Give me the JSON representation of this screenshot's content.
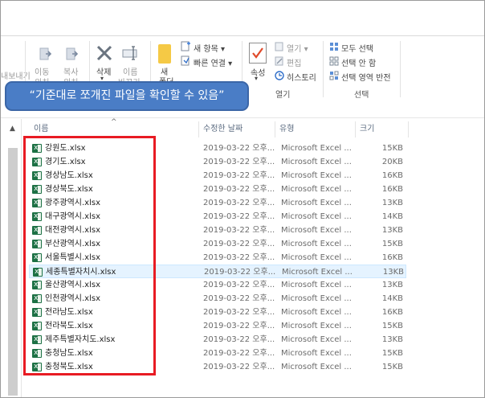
{
  "ribbon": {
    "left_edge_label": "내보내기",
    "move_to": [
      "이동",
      "위치"
    ],
    "copy_to": [
      "복사",
      "위치"
    ],
    "delete": [
      "삭제",
      "▾"
    ],
    "rename": [
      "이름",
      "바꾸기"
    ],
    "new_folder": [
      "새",
      "폴더"
    ],
    "new_item": "새 항목 ▾",
    "easy_access": "빠른 연결 ▾",
    "properties": [
      "속성",
      "▾"
    ],
    "open": "열기 ▾",
    "edit": "편집",
    "history": "히스토리",
    "open_group": "열기",
    "select_all": "모두 선택",
    "select_none": "선택 안 함",
    "invert_selection": "선택 영역 반전",
    "select_group": "선택"
  },
  "callout": {
    "text": "“기준대로 쪼개진 파일을 확인할 수 있음”"
  },
  "columns": {
    "name": "이름",
    "date": "수정한 날짜",
    "type": "유형",
    "size": "크기"
  },
  "files": [
    {
      "name": "강원도.xlsx",
      "date": "2019-03-22 오후...",
      "type": "Microsoft Excel ...",
      "size": "15KB"
    },
    {
      "name": "경기도.xlsx",
      "date": "2019-03-22 오후...",
      "type": "Microsoft Excel ...",
      "size": "20KB"
    },
    {
      "name": "경상남도.xlsx",
      "date": "2019-03-22 오후...",
      "type": "Microsoft Excel ...",
      "size": "16KB"
    },
    {
      "name": "경상북도.xlsx",
      "date": "2019-03-22 오후...",
      "type": "Microsoft Excel ...",
      "size": "16KB"
    },
    {
      "name": "광주광역시.xlsx",
      "date": "2019-03-22 오후...",
      "type": "Microsoft Excel ...",
      "size": "13KB"
    },
    {
      "name": "대구광역시.xlsx",
      "date": "2019-03-22 오후...",
      "type": "Microsoft Excel ...",
      "size": "14KB"
    },
    {
      "name": "대전광역시.xlsx",
      "date": "2019-03-22 오후...",
      "type": "Microsoft Excel ...",
      "size": "13KB"
    },
    {
      "name": "부산광역시.xlsx",
      "date": "2019-03-22 오후...",
      "type": "Microsoft Excel ...",
      "size": "15KB"
    },
    {
      "name": "서울특별시.xlsx",
      "date": "2019-03-22 오후...",
      "type": "Microsoft Excel ...",
      "size": "16KB"
    },
    {
      "name": "세종특별자치시.xlsx",
      "date": "2019-03-22 오후...",
      "type": "Microsoft Excel ...",
      "size": "13KB"
    },
    {
      "name": "울산광역시.xlsx",
      "date": "2019-03-22 오후...",
      "type": "Microsoft Excel ...",
      "size": "13KB"
    },
    {
      "name": "인천광역시.xlsx",
      "date": "2019-03-22 오후...",
      "type": "Microsoft Excel ...",
      "size": "14KB"
    },
    {
      "name": "전라남도.xlsx",
      "date": "2019-03-22 오후...",
      "type": "Microsoft Excel ...",
      "size": "16KB"
    },
    {
      "name": "전라북도.xlsx",
      "date": "2019-03-22 오후...",
      "type": "Microsoft Excel ...",
      "size": "15KB"
    },
    {
      "name": "제주특별자치도.xlsx",
      "date": "2019-03-22 오후...",
      "type": "Microsoft Excel ...",
      "size": "13KB"
    },
    {
      "name": "충청남도.xlsx",
      "date": "2019-03-22 오후...",
      "type": "Microsoft Excel ...",
      "size": "15KB"
    },
    {
      "name": "충청북도.xlsx",
      "date": "2019-03-22 오후...",
      "type": "Microsoft Excel ...",
      "size": "15KB"
    }
  ],
  "selected_row": 9,
  "colors": {
    "callout_bg": "#4a7dc6",
    "highlight_box": "#e81b23",
    "excel_icon": "#1d7145",
    "selected_row": "#e5f3ff"
  }
}
